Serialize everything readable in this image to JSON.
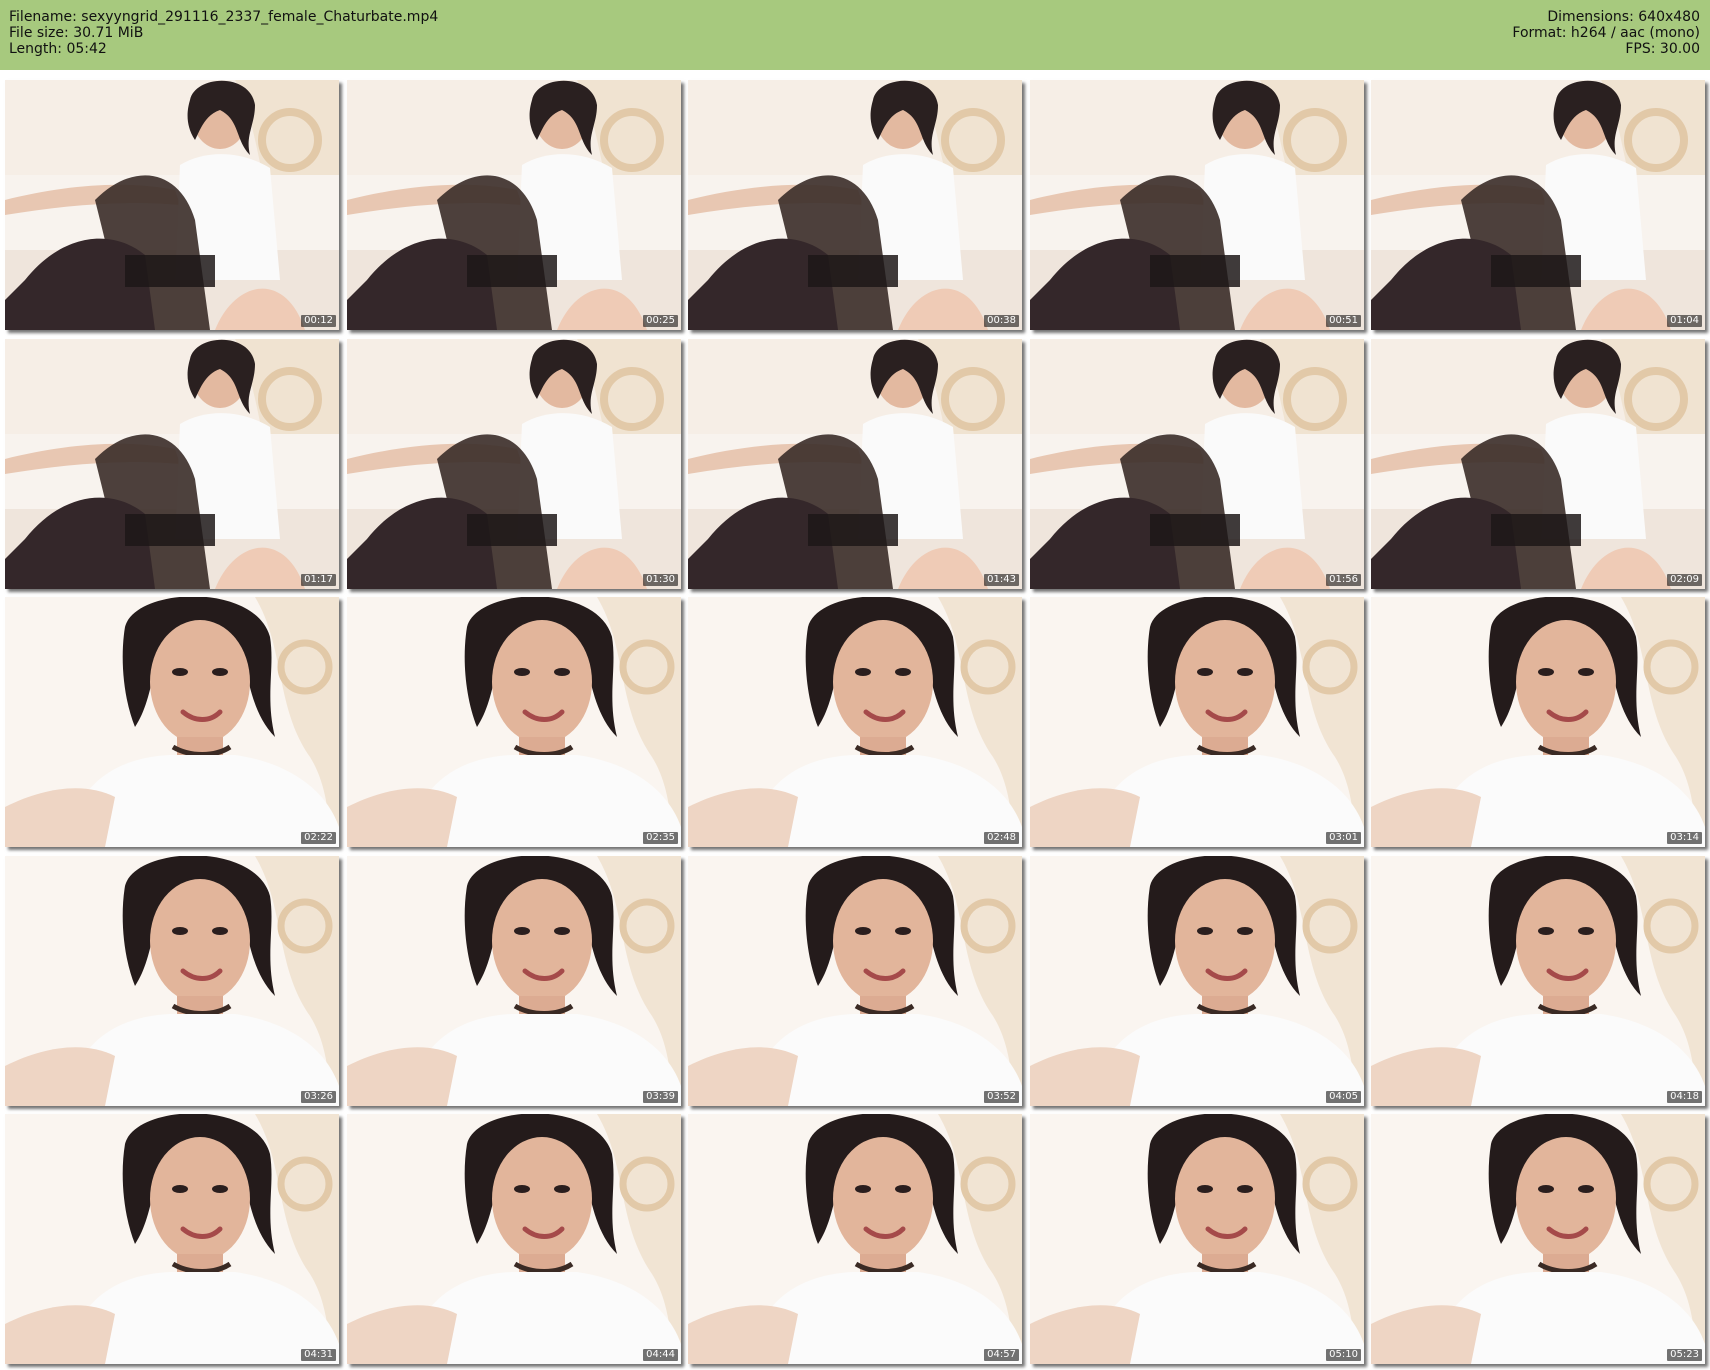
{
  "header": {
    "left": [
      "Filename: sexyyngrid_291116_2337_female_Chaturbate.mp4",
      "File size: 30.71 MiB",
      "Length: 05:42"
    ],
    "right": [
      "Dimensions: 640x480",
      "Format: h264 / aac (mono)",
      "FPS: 30.00"
    ]
  },
  "thumbnails": [
    {
      "time": "00:12",
      "scene": "full"
    },
    {
      "time": "00:25",
      "scene": "full"
    },
    {
      "time": "00:38",
      "scene": "full"
    },
    {
      "time": "00:51",
      "scene": "full"
    },
    {
      "time": "01:04",
      "scene": "full"
    },
    {
      "time": "01:17",
      "scene": "full"
    },
    {
      "time": "01:30",
      "scene": "full"
    },
    {
      "time": "01:43",
      "scene": "full"
    },
    {
      "time": "01:56",
      "scene": "full"
    },
    {
      "time": "02:09",
      "scene": "full"
    },
    {
      "time": "02:22",
      "scene": "close"
    },
    {
      "time": "02:35",
      "scene": "close"
    },
    {
      "time": "02:48",
      "scene": "close"
    },
    {
      "time": "03:01",
      "scene": "close"
    },
    {
      "time": "03:14",
      "scene": "close"
    },
    {
      "time": "03:26",
      "scene": "close"
    },
    {
      "time": "03:39",
      "scene": "close"
    },
    {
      "time": "03:52",
      "scene": "close"
    },
    {
      "time": "04:05",
      "scene": "close"
    },
    {
      "time": "04:18",
      "scene": "close"
    },
    {
      "time": "04:31",
      "scene": "close"
    },
    {
      "time": "04:44",
      "scene": "close"
    },
    {
      "time": "04:57",
      "scene": "close"
    },
    {
      "time": "05:10",
      "scene": "close"
    },
    {
      "time": "05:23",
      "scene": "close"
    }
  ]
}
